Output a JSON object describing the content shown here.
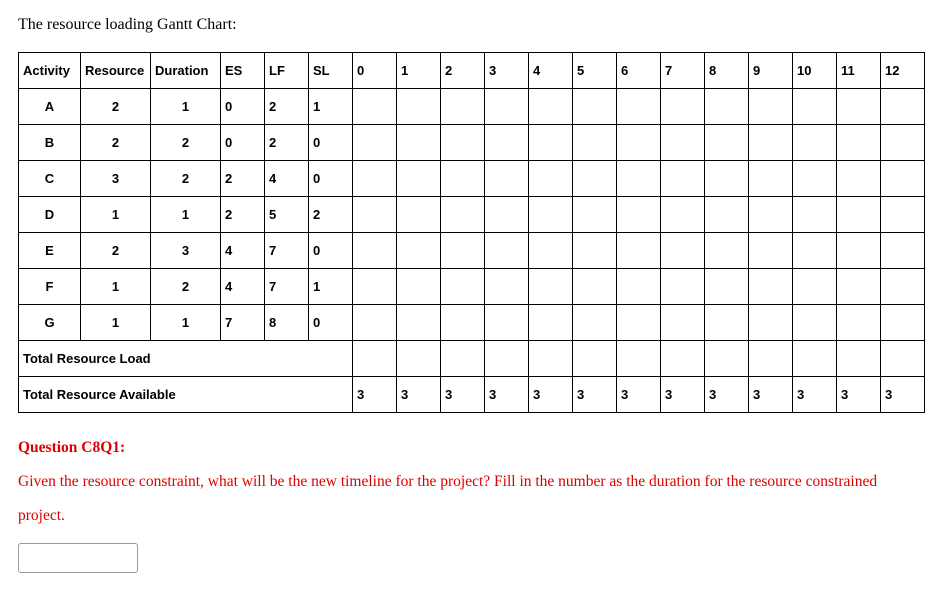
{
  "title": "The resource loading Gantt Chart:",
  "headers": {
    "activity": "Activity",
    "resource": "Resource",
    "duration": "Duration",
    "es": "ES",
    "lf": "LF",
    "sl": "SL",
    "t0": "0",
    "t1": "1",
    "t2": "2",
    "t3": "3",
    "t4": "4",
    "t5": "5",
    "t6": "6",
    "t7": "7",
    "t8": "8",
    "t9": "9",
    "t10": "10",
    "t11": "11",
    "t12": "12"
  },
  "rows": [
    {
      "activity": "A",
      "resource": "2",
      "duration": "1",
      "es": "0",
      "lf": "2",
      "sl": "1"
    },
    {
      "activity": "B",
      "resource": "2",
      "duration": "2",
      "es": "0",
      "lf": "2",
      "sl": "0"
    },
    {
      "activity": "C",
      "resource": "3",
      "duration": "2",
      "es": "2",
      "lf": "4",
      "sl": "0"
    },
    {
      "activity": "D",
      "resource": "1",
      "duration": "1",
      "es": "2",
      "lf": "5",
      "sl": "2"
    },
    {
      "activity": "E",
      "resource": "2",
      "duration": "3",
      "es": "4",
      "lf": "7",
      "sl": "0"
    },
    {
      "activity": "F",
      "resource": "1",
      "duration": "2",
      "es": "4",
      "lf": "7",
      "sl": "1"
    },
    {
      "activity": "G",
      "resource": "1",
      "duration": "1",
      "es": "7",
      "lf": "8",
      "sl": "0"
    }
  ],
  "totals": {
    "load_label": "Total Resource Load",
    "avail_label": "Total Resource Available",
    "avail_values": [
      "3",
      "3",
      "3",
      "3",
      "3",
      "3",
      "3",
      "3",
      "3",
      "3",
      "3",
      "3",
      "3"
    ]
  },
  "question": {
    "title": "Question C8Q1:",
    "text": "Given the resource constraint, what will be the new timeline for the project? Fill in the number as the duration for the resource constrained project."
  }
}
